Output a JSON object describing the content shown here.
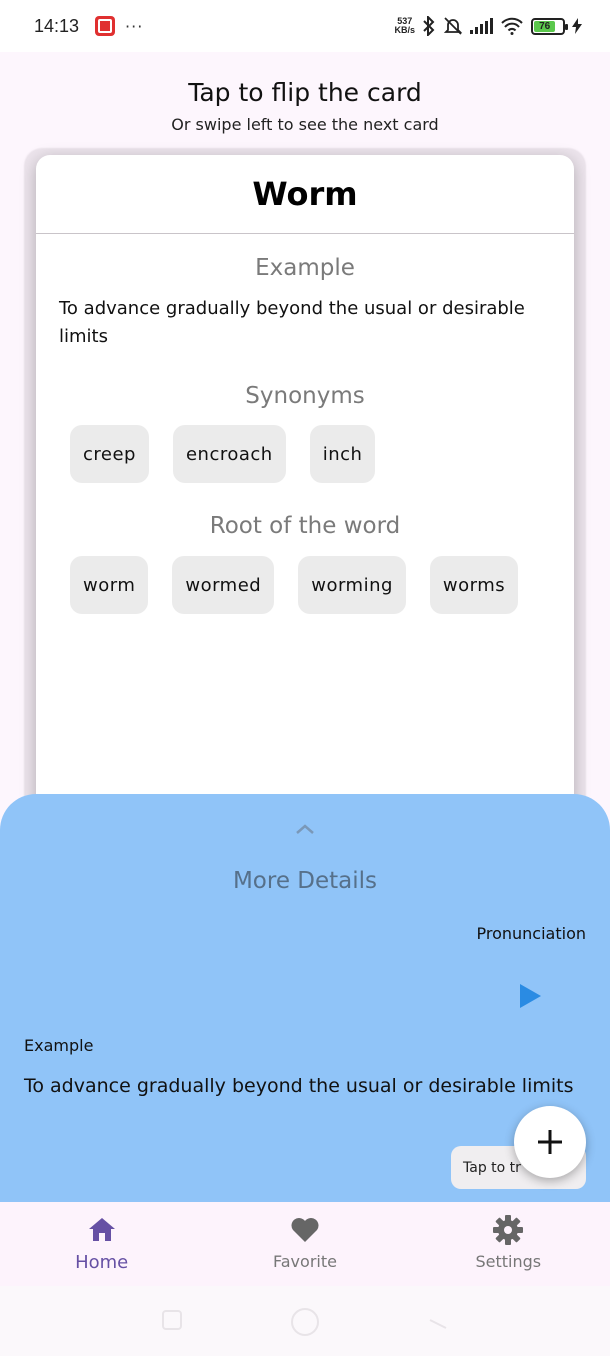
{
  "status_bar": {
    "time": "14:13",
    "dots": "···",
    "net_speed_value": "537",
    "net_speed_unit": "KB/s",
    "battery_level": "76"
  },
  "header": {
    "title": "Tap to flip the card",
    "subtitle": "Or swipe left to see the next card"
  },
  "card": {
    "word": "Worm",
    "example_title": "Example",
    "example_text": "To advance gradually beyond the usual or desirable limits",
    "synonyms_title": "Synonyms",
    "synonyms": [
      "creep",
      "encroach",
      "inch"
    ],
    "root_title": "Root of the word",
    "roots": [
      "worm",
      "wormed",
      "worming",
      "worms"
    ]
  },
  "sheet": {
    "title": "More Details",
    "pronunciation_label": "Pronunciation",
    "example_label": "Example",
    "example_text": "To advance gradually beyond the usual or desirable limits",
    "tooltip": "Tap to tr"
  },
  "nav": {
    "items": [
      {
        "label": "Home",
        "icon": "home-icon"
      },
      {
        "label": "Favorite",
        "icon": "heart-icon"
      },
      {
        "label": "Settings",
        "icon": "gear-icon"
      }
    ]
  },
  "colors": {
    "accent": "#6650a4",
    "sheet": "#90c4f8",
    "play": "#2a8be3"
  }
}
